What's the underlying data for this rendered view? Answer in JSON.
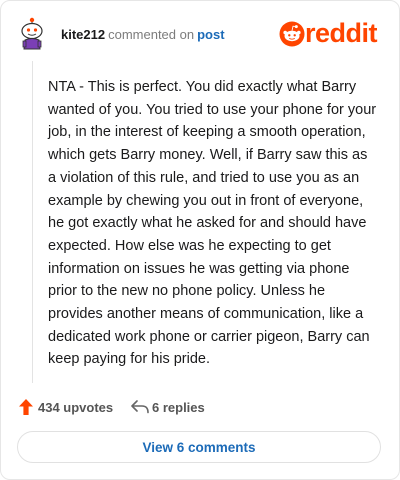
{
  "header": {
    "username": "kite212",
    "action": "commented on",
    "post_link": "post",
    "brand": "reddit",
    "brand_color": "#ff4500"
  },
  "comment": {
    "text": "NTA - This is perfect. You did exactly what Barry wanted of you. You tried to use your phone for your job, in the interest of keeping a smooth operation, which gets Barry money. Well, if Barry saw this as a violation of this rule, and tried to use you as an example by chewing you out in front of everyone, he got exactly what he asked for and should have expected. How else was he expecting to get information on issues he was getting via phone prior to the new no phone policy. Unless he provides another means of communication, like a dedicated work phone or carrier pigeon, Barry can keep paying for his pride."
  },
  "actions": {
    "upvotes_label": "434 upvotes",
    "replies_label": "6 replies",
    "upvote_icon": "upvote-arrow-icon",
    "reply_icon": "reply-arrow-icon"
  },
  "footer": {
    "view_comments_label": "View 6 comments",
    "link_color": "#1c6bb8"
  }
}
